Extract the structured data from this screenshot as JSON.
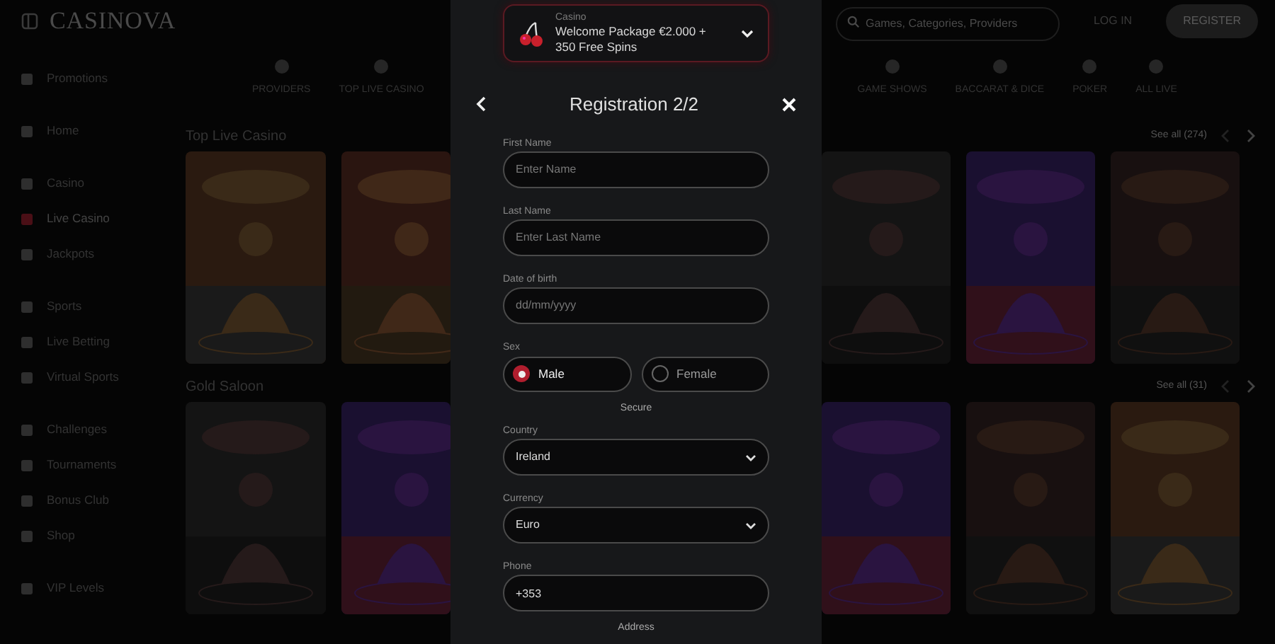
{
  "header": {
    "logo": "CASINOVA",
    "search": {
      "placeholder": "Games, Categories, Providers"
    },
    "login": "LOG IN",
    "register": "REGISTER"
  },
  "sidebar": {
    "items": [
      {
        "label": "Promotions",
        "selected": false
      },
      {
        "label": "Home",
        "selected": false
      },
      {
        "label": "Casino",
        "selected": false
      },
      {
        "label": "Live Casino",
        "selected": true
      },
      {
        "label": "Jackpots",
        "selected": false
      },
      {
        "label": "Sports",
        "selected": false
      },
      {
        "label": "Live Betting",
        "selected": false
      },
      {
        "label": "Virtual Sports",
        "selected": false
      },
      {
        "label": "Challenges",
        "selected": false
      },
      {
        "label": "Tournaments",
        "selected": false
      },
      {
        "label": "Bonus Club",
        "selected": false
      },
      {
        "label": "Shop",
        "selected": false
      },
      {
        "label": "VIP Levels",
        "selected": false
      }
    ]
  },
  "categories_left": [
    "PROVIDERS",
    "TOP LIVE CASINO"
  ],
  "categories_right": [
    "GAME SHOWS",
    "BACCARAT & DICE",
    "POKER",
    "ALL LIVE"
  ],
  "sections": [
    {
      "title": "Top Live Casino",
      "see_all": "See all (274)"
    },
    {
      "title": "Gold Saloon",
      "see_all": "See all (31)"
    }
  ],
  "modal": {
    "offer": {
      "category": "Casino",
      "text": "Welcome Package €2.000 + 350 Free Spins"
    },
    "title": "Registration 2/2",
    "fields": [
      {
        "kind": "text",
        "label": "First Name",
        "placeholder": "Enter Name"
      },
      {
        "kind": "text",
        "label": "Last Name",
        "placeholder": "Enter Last Name"
      },
      {
        "kind": "text",
        "label": "Date of birth",
        "placeholder": "dd/mm/yyyy"
      },
      {
        "kind": "radio",
        "label": "Sex",
        "options": [
          {
            "label": "Male",
            "selected": true
          },
          {
            "label": "Female",
            "selected": false
          }
        ]
      },
      {
        "kind": "heading",
        "label": "Secure"
      },
      {
        "kind": "select",
        "label": "Country",
        "value": "Ireland"
      },
      {
        "kind": "select",
        "label": "Currency",
        "value": "Euro"
      },
      {
        "kind": "text",
        "label": "Phone",
        "value": "+353"
      },
      {
        "kind": "heading",
        "label": "Address"
      }
    ]
  }
}
